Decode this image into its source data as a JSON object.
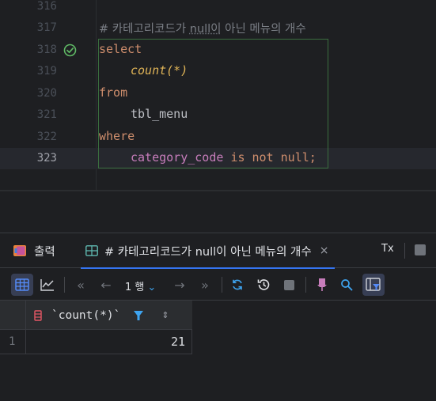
{
  "editor": {
    "lines": [
      {
        "num": "316"
      },
      {
        "num": "317",
        "comment_prefix": "# 카테고리코드가 ",
        "comment_dotted": "null이",
        "comment_suffix": " 아닌 메뉴의 개수"
      },
      {
        "num": "318",
        "keyword": "select"
      },
      {
        "num": "319",
        "func": "count(*)"
      },
      {
        "num": "320",
        "keyword": "from"
      },
      {
        "num": "321",
        "ident": "tbl_menu"
      },
      {
        "num": "322",
        "keyword": "where"
      },
      {
        "num": "323",
        "column": "category_code",
        "kw_is": "is",
        "kw_not": "not",
        "kw_null": "null",
        "semi": ";"
      }
    ],
    "run_marker_icon": "check-circle-icon"
  },
  "tabs": {
    "output_label": "출력",
    "result_label": "# 카테고리코드가 null이 아닌 메뉴의 개수",
    "close_glyph": "×",
    "tx_label": "Tx"
  },
  "toolbar": {
    "page_label": "1 행",
    "page_chevron": "⌄",
    "first_glyph": "«",
    "prev_glyph": "←",
    "next_glyph": "→",
    "last_glyph": "»"
  },
  "grid": {
    "column_title": "`count(*)`",
    "sort_glyph": "⇕",
    "rows": [
      {
        "num": "1",
        "value": "21"
      }
    ]
  },
  "colors": {
    "background": "#1e1f22",
    "keyword": "#cf8e6d",
    "function": "#e0b457",
    "column": "#c77dbb",
    "comment": "#7a7e85",
    "accent": "#3574f0",
    "check_green": "#5fb865"
  }
}
